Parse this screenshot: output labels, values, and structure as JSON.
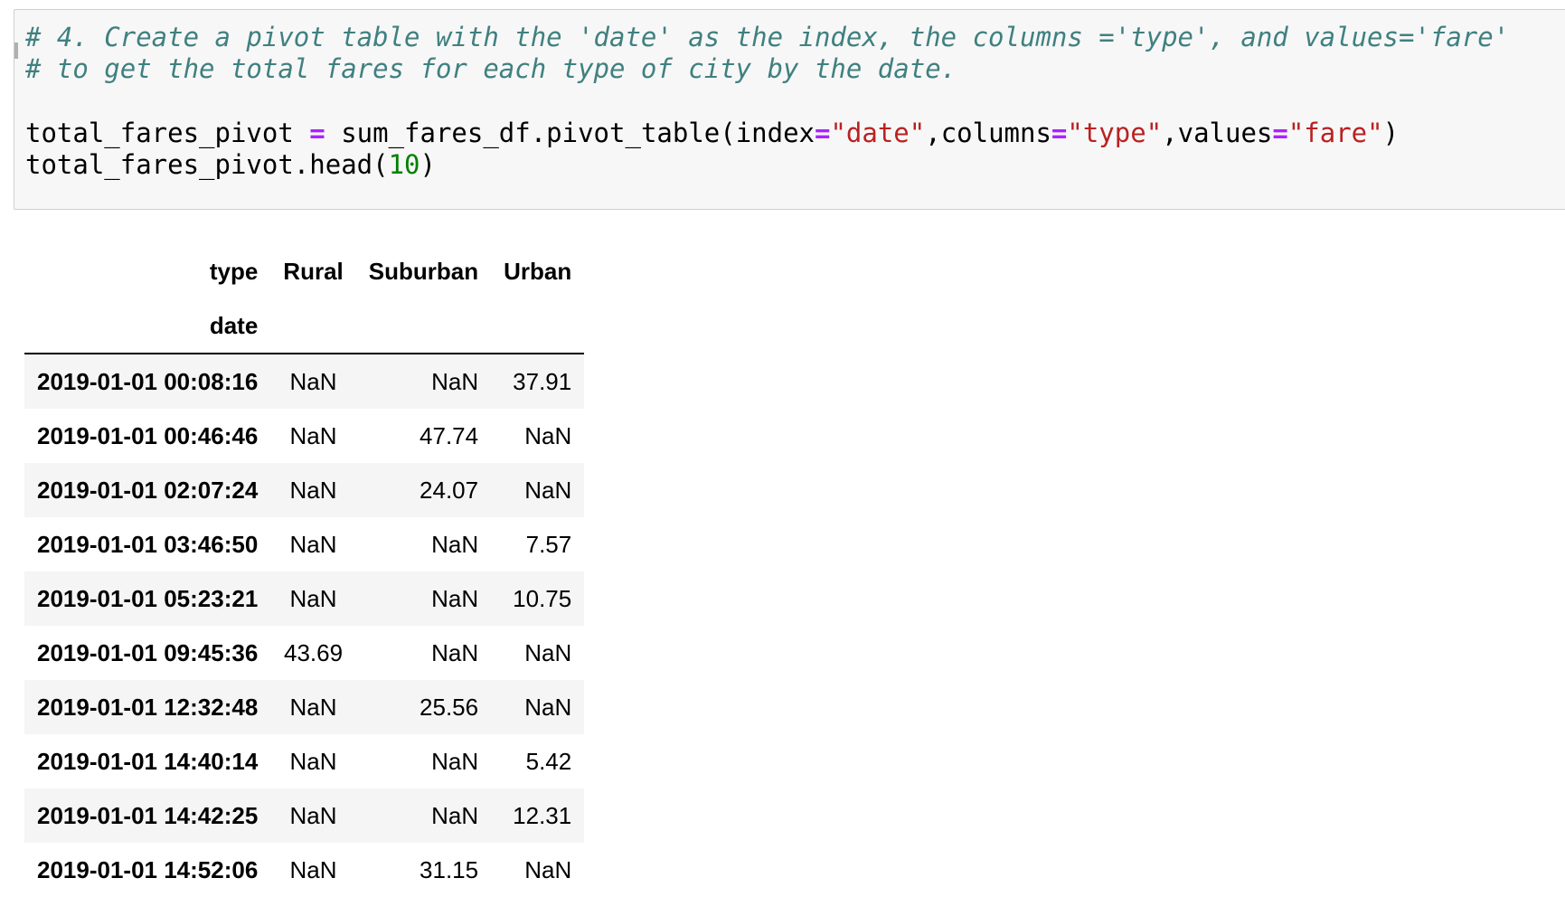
{
  "code_cell": {
    "comment_line_1": "# 4. Create a pivot table with the 'date' as the index, the columns ='type', and values='fare'",
    "comment_line_2": "# to get the total fares for each type of city by the date.",
    "line_3": {
      "var": "total_fares_pivot ",
      "eq": "=",
      "call": " sum_fares_df.pivot_table(index",
      "eq2": "=",
      "arg1": "\"date\"",
      "mid1": ",columns",
      "eq3": "=",
      "arg2": "\"type\"",
      "mid2": ",values",
      "eq4": "=",
      "arg3": "\"fare\"",
      "close": ")"
    },
    "line_4": {
      "call": "total_fares_pivot.head(",
      "num": "10",
      "close": ")"
    }
  },
  "table": {
    "columns_name": "type",
    "index_name": "date",
    "columns": [
      "Rural",
      "Suburban",
      "Urban"
    ],
    "rows": [
      {
        "date": "2019-01-01 00:08:16",
        "rural": "NaN",
        "suburban": "NaN",
        "urban": "37.91"
      },
      {
        "date": "2019-01-01 00:46:46",
        "rural": "NaN",
        "suburban": "47.74",
        "urban": "NaN"
      },
      {
        "date": "2019-01-01 02:07:24",
        "rural": "NaN",
        "suburban": "24.07",
        "urban": "NaN"
      },
      {
        "date": "2019-01-01 03:46:50",
        "rural": "NaN",
        "suburban": "NaN",
        "urban": "7.57"
      },
      {
        "date": "2019-01-01 05:23:21",
        "rural": "NaN",
        "suburban": "NaN",
        "urban": "10.75"
      },
      {
        "date": "2019-01-01 09:45:36",
        "rural": "43.69",
        "suburban": "NaN",
        "urban": "NaN"
      },
      {
        "date": "2019-01-01 12:32:48",
        "rural": "NaN",
        "suburban": "25.56",
        "urban": "NaN"
      },
      {
        "date": "2019-01-01 14:40:14",
        "rural": "NaN",
        "suburban": "NaN",
        "urban": "5.42"
      },
      {
        "date": "2019-01-01 14:42:25",
        "rural": "NaN",
        "suburban": "NaN",
        "urban": "12.31"
      },
      {
        "date": "2019-01-01 14:52:06",
        "rural": "NaN",
        "suburban": "31.15",
        "urban": "NaN"
      }
    ]
  }
}
